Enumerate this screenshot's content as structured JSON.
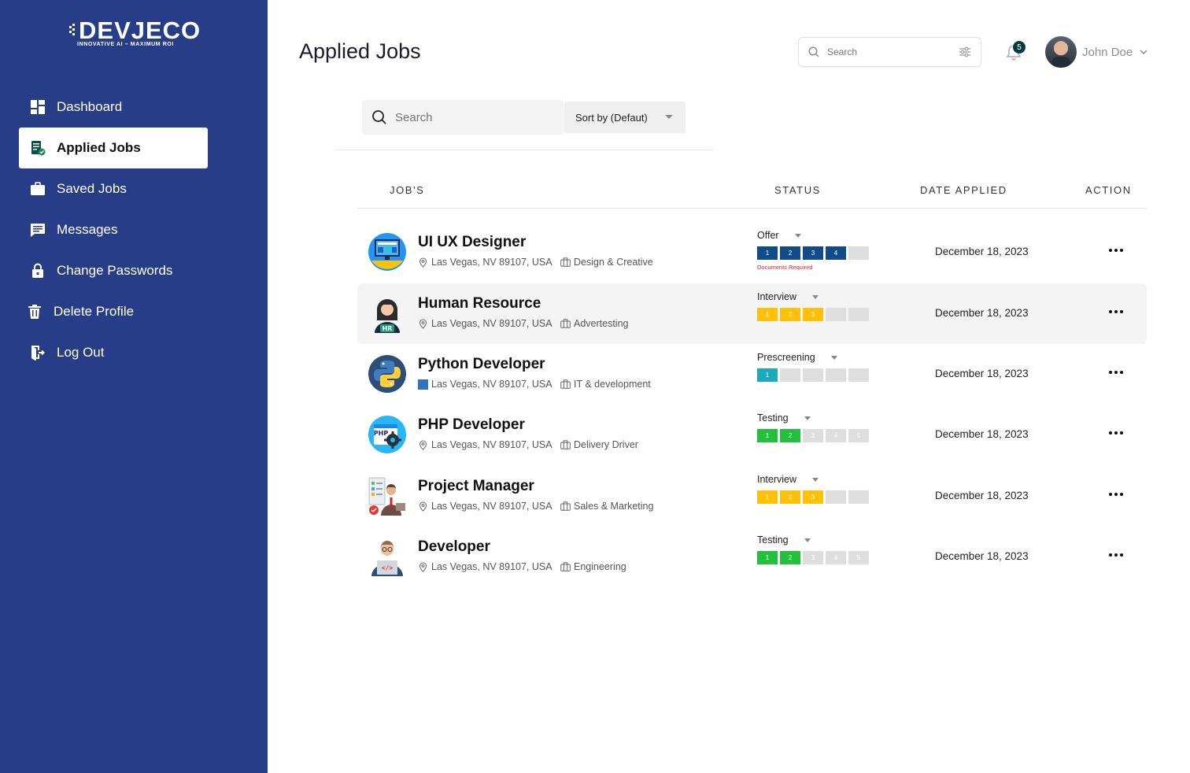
{
  "brand": {
    "name": "DEVJECO",
    "tagline": "INNOVATIVE AI – MAXIMUM ROI"
  },
  "sidebar": {
    "items": [
      {
        "label": "Dashboard",
        "icon": "dashboard-icon"
      },
      {
        "label": "Applied Jobs",
        "icon": "applied-jobs-icon",
        "active": true
      },
      {
        "label": "Saved Jobs",
        "icon": "briefcase-icon"
      },
      {
        "label": "Messages",
        "icon": "message-icon"
      },
      {
        "label": "Change Passwords",
        "icon": "lock-icon"
      },
      {
        "label": "Delete Profile",
        "icon": "trash-icon"
      },
      {
        "label": "Log Out",
        "icon": "logout-icon"
      }
    ]
  },
  "header": {
    "title": "Applied Jobs",
    "search_placeholder": "Search",
    "notifications": "5",
    "user_name": "John Doe"
  },
  "filters": {
    "search_placeholder": "Search",
    "sort_label": "Sort by (Defaut)"
  },
  "table": {
    "headers": {
      "jobs": "JOB'S",
      "status": "STATUS",
      "date": "DATE APPLIED",
      "action": "ACTION"
    },
    "rows": [
      {
        "title": "UI UX Designer",
        "location": "Las Vegas, NV 89107, USA",
        "category": "Design & Creative",
        "icon": "ui-ux-designer-icon",
        "status": "Offer",
        "steps": [
          "1",
          "2",
          "3",
          "4",
          ""
        ],
        "filled": 4,
        "step_color": "#0f4c8a",
        "note": "Documents Required",
        "date": "December 18, 2023"
      },
      {
        "title": "Human Resource",
        "location": "Las Vegas, NV 89107, USA",
        "category": "Advertesting",
        "icon": "human-resource-icon",
        "status": "Interview",
        "steps": [
          "1",
          "2",
          "3",
          "",
          ""
        ],
        "filled": 3,
        "step_color": "#ffc107",
        "note": "",
        "date": "December 18, 2023",
        "highlight": true
      },
      {
        "title": "Python Developer",
        "location": "Las Vegas, NV 89107, USA",
        "category": "IT & development",
        "icon": "python-icon",
        "status": "Prescreening",
        "steps": [
          "1",
          "",
          "",
          "",
          ""
        ],
        "filled": 1,
        "step_color": "#1fa8b8",
        "note": "",
        "date": "December 18, 2023"
      },
      {
        "title": "PHP Developer",
        "location": "Las Vegas, NV 89107, USA",
        "category": "Delivery Driver",
        "icon": "php-icon",
        "status": "Testing",
        "steps": [
          "1",
          "2",
          "3",
          "4",
          "5"
        ],
        "filled": 2,
        "step_color": "#22c03c",
        "note": "",
        "date": "December 18, 2023"
      },
      {
        "title": "Project Manager",
        "location": "Las Vegas, NV 89107, USA",
        "category": "Sales & Marketing",
        "icon": "project-manager-icon",
        "status": "Interview",
        "steps": [
          "1",
          "2",
          "3",
          "",
          ""
        ],
        "filled": 3,
        "step_color": "#ffc107",
        "note": "",
        "date": "December 18, 2023"
      },
      {
        "title": " Developer",
        "location": "Las Vegas, NV 89107, USA",
        "category": "Engineering",
        "icon": "developer-icon",
        "status": "Testing",
        "steps": [
          "1",
          "2",
          "3",
          "4",
          "5"
        ],
        "filled": 2,
        "step_color": "#22c03c",
        "note": "",
        "date": "December 18, 2023"
      }
    ]
  },
  "colors": {
    "sidebar": "#283d88",
    "accent_navy": "#0f4c8a",
    "accent_yellow": "#ffc107",
    "accent_teal": "#1fa8b8",
    "accent_green": "#22c03c",
    "note_red": "#e02424"
  }
}
